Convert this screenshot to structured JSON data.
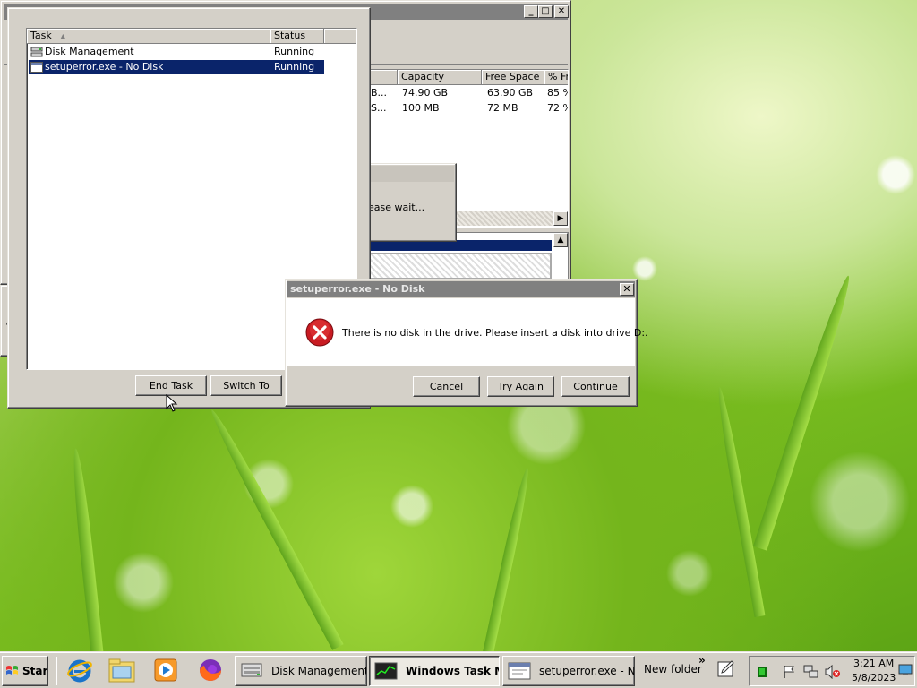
{
  "task_manager": {
    "columns": {
      "task": "Task",
      "status": "Status"
    },
    "tasks": [
      {
        "name": "Disk Management",
        "status": "Running",
        "icon": "disk-management-icon"
      },
      {
        "name": "setuperror.exe - No Disk",
        "status": "Running",
        "icon": "window-icon"
      }
    ],
    "end_task_label": "End Task",
    "switch_to_label": "Switch To"
  },
  "disk_management": {
    "columns": {
      "capacity": "Capacity",
      "free_space": "Free Space",
      "percent_free": "% Fr"
    },
    "volumes": [
      {
        "col_b": "B...",
        "capacity": "74.90 GB",
        "free_space": "63.90 GB",
        "percent_free": "85 %"
      },
      {
        "col_b": "S...",
        "capacity": "100 MB",
        "free_space": "72 MB",
        "percent_free": "72 %"
      }
    ],
    "caption_controls": {
      "minimize": "_",
      "maximize": "□",
      "close": "✕"
    }
  },
  "loading_box": {
    "text": "ease wait..."
  },
  "error_dialog": {
    "title": "setuperror.exe - No Disk",
    "message": "There is no disk in the drive. Please insert a disk into drive D:.",
    "icon": "error-icon",
    "buttons": {
      "cancel": "Cancel",
      "try_again": "Try Again",
      "continue": "Continue"
    }
  },
  "taskbar": {
    "start_label": "Start",
    "quick_launch": [
      "internet-explorer-icon",
      "windows-explorer-icon",
      "media-player-icon",
      "firefox-icon"
    ],
    "buttons": [
      {
        "label": "Disk Management",
        "active": false
      },
      {
        "label": "Windows Task M...",
        "active": true
      },
      {
        "label": "setuperror.exe - N...",
        "active": false
      }
    ],
    "toolbar_label": "New folder",
    "chevron": "»",
    "clock_time": "3:21 AM",
    "clock_date": "5/8/2023"
  },
  "colors": {
    "selection": "#0a246a",
    "title_inactive": "#808080",
    "desktop_green": "#7cc021",
    "error_red": "#c81b22"
  }
}
